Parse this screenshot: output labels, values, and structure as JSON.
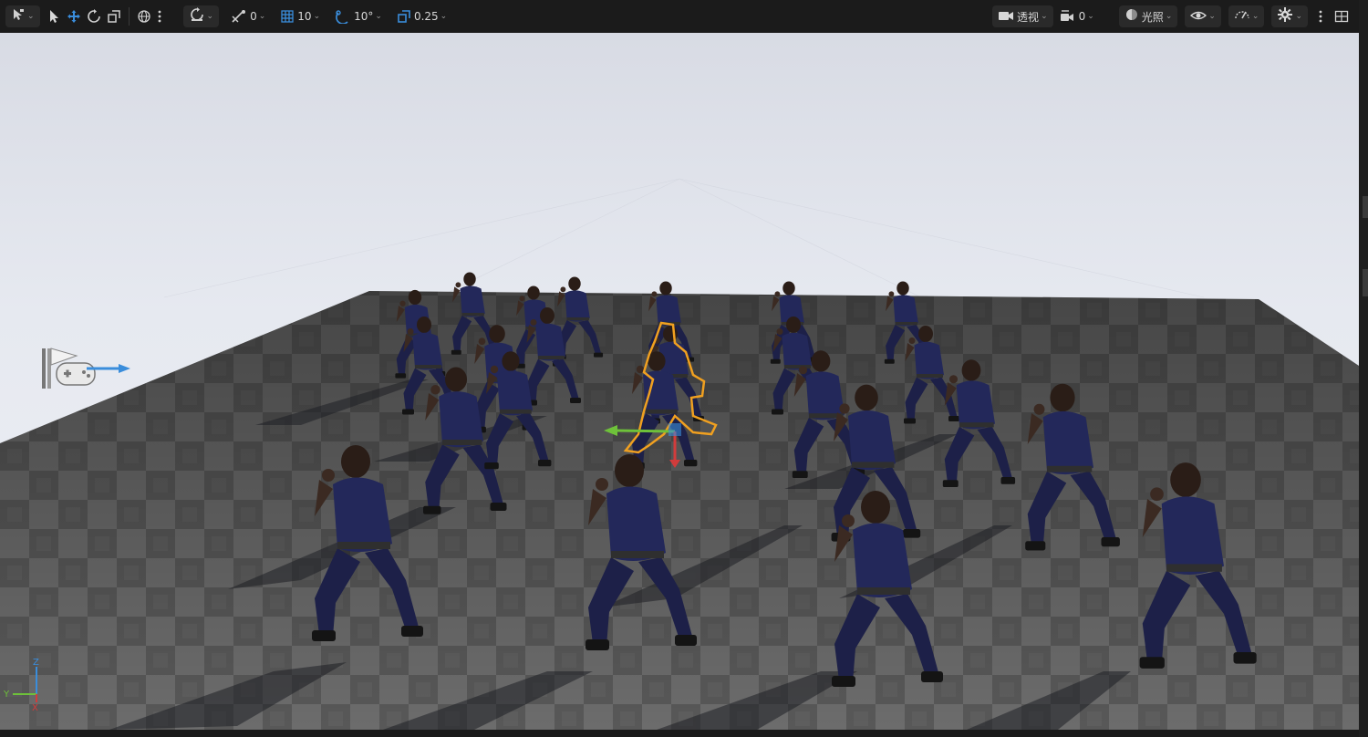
{
  "toolbar": {
    "translate_snap": "0",
    "grid_snap": "10",
    "rotate_snap": "10°",
    "scale_snap": "0.25",
    "view_mode": "透视",
    "camera_speed": "0",
    "lighting_mode": "光照"
  },
  "icons": [
    "select-mode-icon",
    "select-arrow-icon",
    "translate-icon",
    "rotate-icon",
    "scale-icon",
    "world-local-icon",
    "more-vertical-icon",
    "surface-snap-icon",
    "translate-snap-icon",
    "grid-snap-icon",
    "rotate-snap-icon",
    "scale-snap-icon",
    "perspective-camera-icon",
    "camera-speed-icon",
    "lighting-sphere-icon",
    "show-eye-icon",
    "realtime-icon",
    "settings-gear-icon",
    "layout-icon",
    "player-start-icon",
    "axis-gizmo-icon"
  ],
  "colors": {
    "accent_blue": "#3a8ddb",
    "selection_orange": "#f0a020",
    "gizmo_green": "#6ec13a",
    "gizmo_red": "#d23c3c",
    "character_blue": "#23285a"
  },
  "axis": {
    "x": "X",
    "y": "Y",
    "z": "Z"
  }
}
